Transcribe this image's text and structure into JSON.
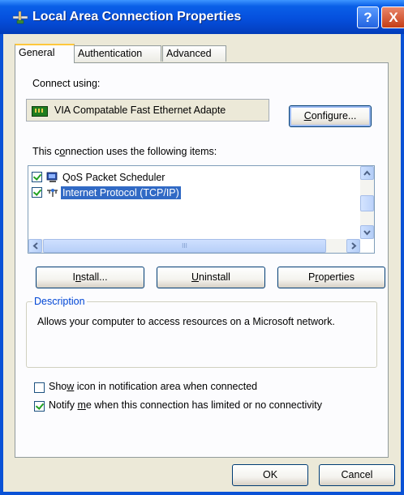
{
  "window": {
    "title": "Local Area Connection Properties",
    "help_label": "?",
    "close_label": "X"
  },
  "tabs": [
    {
      "label": "General"
    },
    {
      "label": "Authentication"
    },
    {
      "label": "Advanced"
    }
  ],
  "connect_using": {
    "label_pre": "Connect using:",
    "adapter_name": "VIA Compatable Fast Ethernet Adapte",
    "configure_pre": "",
    "configure_hot": "C",
    "configure_post": "onfigure..."
  },
  "items_section": {
    "label_pre": "This c",
    "label_hot": "o",
    "label_post": "nnection uses the following items:",
    "items": [
      {
        "label": "QoS Packet Scheduler",
        "checked": true,
        "selected": false
      },
      {
        "label": "Internet Protocol (TCP/IP)",
        "checked": true,
        "selected": true
      }
    ],
    "hscroll_grip": "III"
  },
  "buttons": {
    "install_pre": "I",
    "install_hot": "n",
    "install_post": "stall...",
    "uninstall_pre": "",
    "uninstall_hot": "U",
    "uninstall_post": "ninstall",
    "properties_pre": "P",
    "properties_hot": "r",
    "properties_post": "operties"
  },
  "description": {
    "title": "Description",
    "text": "Allows your computer to access resources on a Microsoft network."
  },
  "options": {
    "show_icon_pre": "Sho",
    "show_icon_hot": "w",
    "show_icon_post": " icon in notification area when connected",
    "show_icon_checked": false,
    "notify_pre": "Notify ",
    "notify_hot": "m",
    "notify_post": "e when this connection has limited or no connectivity",
    "notify_checked": true
  },
  "dialog_buttons": {
    "ok": "OK",
    "cancel": "Cancel"
  }
}
